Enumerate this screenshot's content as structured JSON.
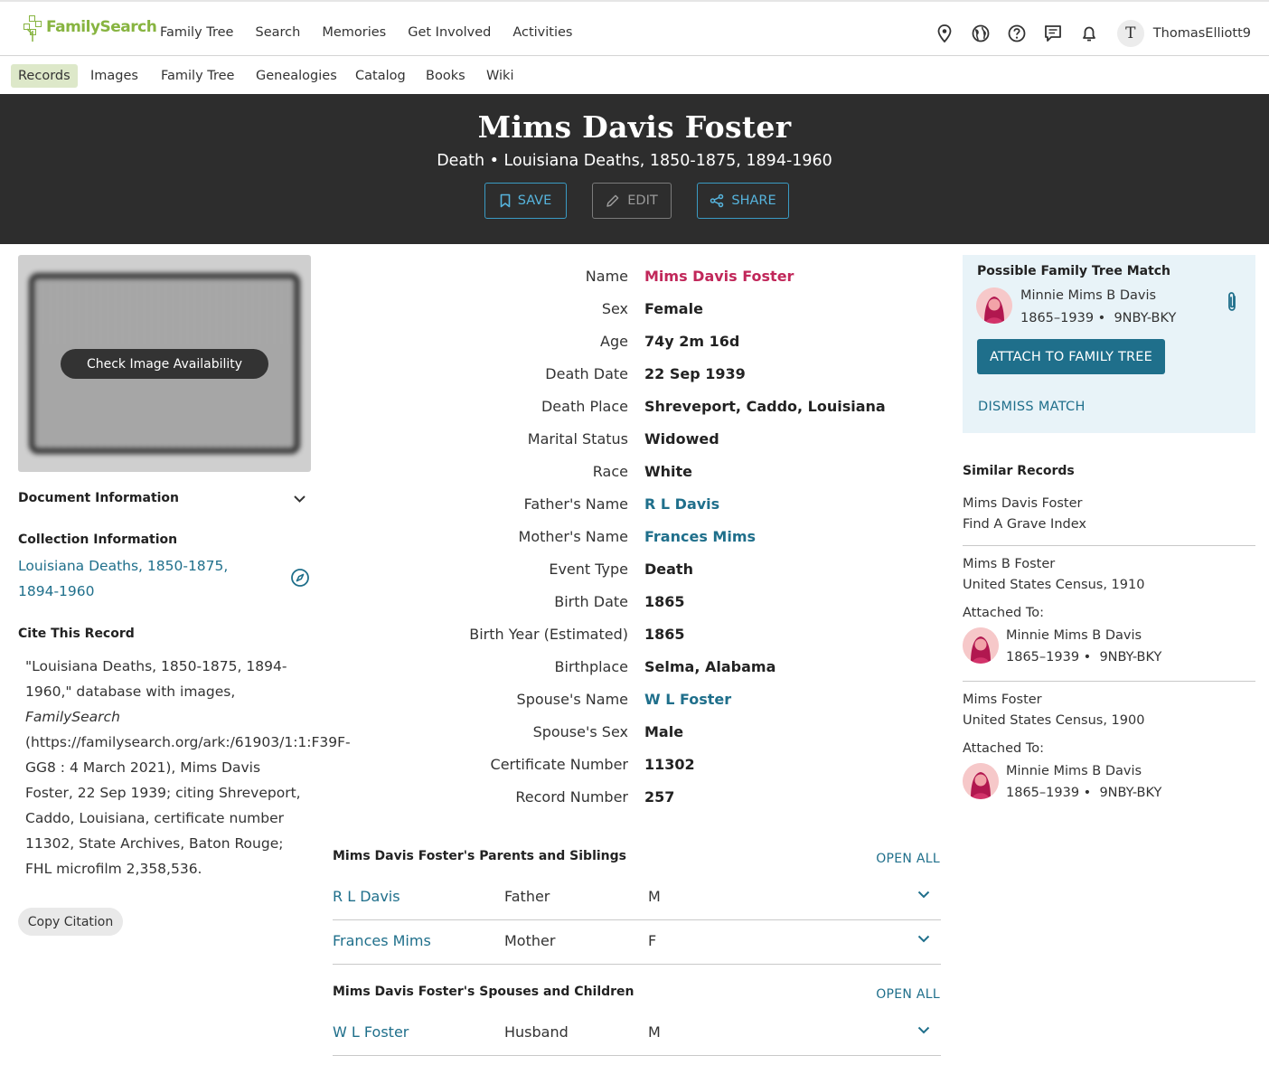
{
  "topnav": {
    "logo_text": "FamilySearch",
    "items": [
      "Family Tree",
      "Search",
      "Memories",
      "Get Involved",
      "Activities"
    ],
    "avatar_letter": "T",
    "username": "ThomasElliott9"
  },
  "subnav": {
    "items": [
      "Records",
      "Images",
      "Family Tree",
      "Genealogies",
      "Catalog",
      "Books",
      "Wiki"
    ],
    "active": "Records"
  },
  "hero": {
    "title": "Mims Davis Foster",
    "subtitle": "Death • Louisiana Deaths, 1850-1875, 1894-1960",
    "save_label": "SAVE",
    "edit_label": "EDIT",
    "share_label": "SHARE"
  },
  "left": {
    "check_image_label": "Check Image Availability",
    "document_info_label": "Document Information",
    "collection_info_label": "Collection Information",
    "collection_link": "Louisiana Deaths, 1850-1875, 1894-1960",
    "cite_label": "Cite This Record",
    "citation_pre": "\"Louisiana Deaths, 1850-1875, 1894-1960,\" database with images, ",
    "citation_italic": "FamilySearch",
    "citation_post": " (https://familysearch.org/ark:/61903/1:1:F39F-GG8 : 4 March 2021), Mims Davis Foster, 22 Sep 1939; citing Shreveport, Caddo, Louisiana, certificate number 11302, State Archives, Baton Rouge; FHL microfilm 2,358,536.",
    "copy_citation_label": "Copy Citation"
  },
  "facts": [
    {
      "label": "Name",
      "value": "Mims Davis Foster",
      "style": "name"
    },
    {
      "label": "Sex",
      "value": "Female",
      "style": "plain"
    },
    {
      "label": "Age",
      "value": "74y 2m 16d",
      "style": "plain"
    },
    {
      "label": "Death Date",
      "value": "22 Sep 1939",
      "style": "plain"
    },
    {
      "label": "Death Place",
      "value": "Shreveport, Caddo, Louisiana",
      "style": "plain"
    },
    {
      "label": "Marital Status",
      "value": "Widowed",
      "style": "plain"
    },
    {
      "label": "Race",
      "value": "White",
      "style": "plain"
    },
    {
      "label": "Father's Name",
      "value": "R L Davis",
      "style": "link"
    },
    {
      "label": "Mother's Name",
      "value": "Frances Mims",
      "style": "link"
    },
    {
      "label": "Event Type",
      "value": "Death",
      "style": "plain"
    },
    {
      "label": "Birth Date",
      "value": "1865",
      "style": "plain"
    },
    {
      "label": "Birth Year (Estimated)",
      "value": "1865",
      "style": "plain"
    },
    {
      "label": "Birthplace",
      "value": "Selma, Alabama",
      "style": "plain"
    },
    {
      "label": "Spouse's Name",
      "value": "W L Foster",
      "style": "link"
    },
    {
      "label": "Spouse's Sex",
      "value": "Male",
      "style": "plain"
    },
    {
      "label": "Certificate Number",
      "value": "11302",
      "style": "plain"
    },
    {
      "label": "Record Number",
      "value": "257",
      "style": "plain"
    }
  ],
  "parents_section": {
    "title": "Mims Davis Foster's Parents and Siblings",
    "open_all": "OPEN ALL",
    "rows": [
      {
        "name": "R L Davis",
        "relation": "Father",
        "sex": "M"
      },
      {
        "name": "Frances Mims",
        "relation": "Mother",
        "sex": "F"
      }
    ]
  },
  "spouses_section": {
    "title": "Mims Davis Foster's Spouses and Children",
    "open_all": "OPEN ALL",
    "rows": [
      {
        "name": "W L Foster",
        "relation": "Husband",
        "sex": "M"
      }
    ]
  },
  "match": {
    "title": "Possible Family Tree Match",
    "person_name": "Minnie Mims B Davis",
    "lifespan": "1865–1939",
    "pid": "9NBY-BKY",
    "attach_label": "ATTACH TO FAMILY TREE",
    "dismiss_label": "DISMISS MATCH"
  },
  "similar": {
    "title": "Similar Records",
    "attached_to_label": "Attached To:",
    "records": [
      {
        "name": "Mims Davis Foster",
        "collection": "Find A Grave Index"
      },
      {
        "name": "Mims B Foster",
        "collection": "United States Census, 1910",
        "attached_name": "Minnie Mims B Davis",
        "lifespan": "1865–1939",
        "pid": "9NBY-BKY"
      },
      {
        "name": "Mims Foster",
        "collection": "United States Census, 1900",
        "attached_name": "Minnie Mims B Davis",
        "lifespan": "1865–1939",
        "pid": "9NBY-BKY"
      }
    ]
  },
  "colors": {
    "hero_bg": "#2d2d2d",
    "link": "#1f6f8b",
    "name_accent": "#c1275a",
    "brand_green": "#87b440",
    "match_bg": "#e8f3f8"
  }
}
